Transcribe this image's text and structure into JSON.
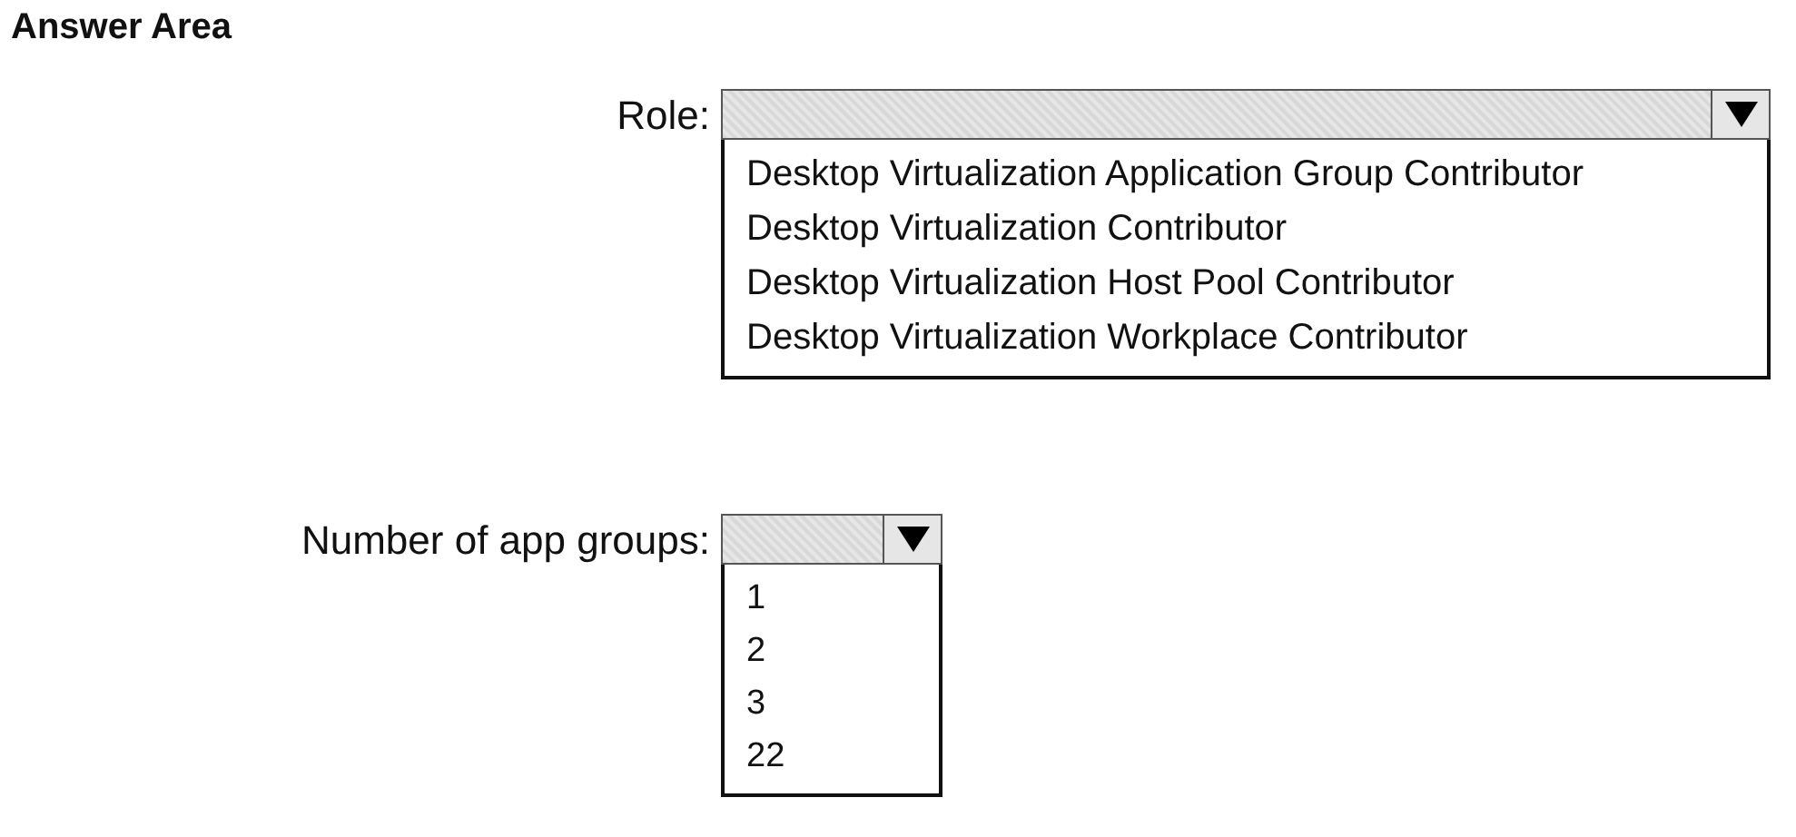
{
  "title": "Answer Area",
  "questions": [
    {
      "label": "Role:",
      "kind": "wide",
      "options": [
        "Desktop Virtualization Application Group Contributor",
        "Desktop Virtualization Contributor",
        "Desktop Virtualization Host Pool Contributor",
        "Desktop Virtualization Workplace Contributor"
      ]
    },
    {
      "label": "Number of app groups:",
      "kind": "narrow",
      "options": [
        "1",
        "2",
        "3",
        "22"
      ]
    }
  ]
}
